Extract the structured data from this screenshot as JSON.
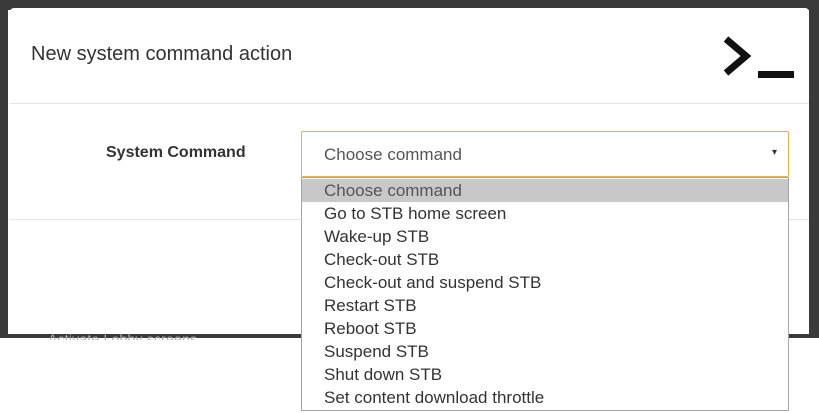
{
  "background": {
    "faded_text": "Activate Lobby screens"
  },
  "modal": {
    "title": "New system command action",
    "header_icon": "terminal-icon"
  },
  "form": {
    "label": "System Command",
    "select": {
      "value": "Choose command",
      "caret": "▾"
    },
    "options": [
      "Choose command",
      "Go to STB home screen",
      "Wake-up STB",
      "Check-out STB",
      "Check-out and suspend STB",
      "Restart STB",
      "Reboot STB",
      "Suspend STB",
      "Shut down STB",
      "Set content download throttle"
    ],
    "selected_index": 0
  },
  "colors": {
    "focus_border": "#f0ad4e",
    "selected_option": "#c8c8c8",
    "backdrop": "#3a3a3a"
  }
}
